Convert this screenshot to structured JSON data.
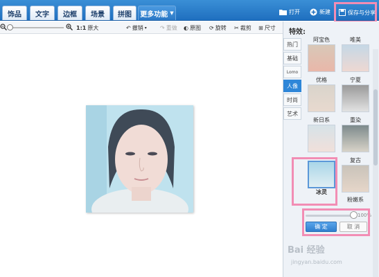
{
  "tabs": [
    "饰品",
    "文字",
    "边框",
    "场景",
    "拼图"
  ],
  "more_tab": "更多功能",
  "top_actions": {
    "open": "打开",
    "new": "新建",
    "save_share": "保存与分享"
  },
  "toolbar": {
    "ratio": "1:1",
    "original_size": "原大",
    "undo": "撤销",
    "redo": "重做",
    "compare": "原图",
    "rotate": "旋转",
    "crop": "裁剪",
    "size": "尺寸"
  },
  "panel": {
    "title": "特效:",
    "categories": [
      "热门",
      "基础",
      "Lomo",
      "人像",
      "时尚",
      "艺术"
    ],
    "active_category": "人像",
    "effects": [
      {
        "label": "阿宝色"
      },
      {
        "label": "唯美"
      },
      {
        "label": "优格"
      },
      {
        "label": "宁夏"
      },
      {
        "label": "新日系"
      },
      {
        "label": "重染"
      },
      {
        "label": "冰灵"
      },
      {
        "label": "复古"
      },
      {
        "label": "粉嫩系"
      }
    ],
    "selected_effect": "冰灵",
    "opacity_value": "100%",
    "confirm": "确 定",
    "cancel": "取 消"
  },
  "watermark": {
    "main": "Bai 经验",
    "sub": "jingyan.baidu.com"
  },
  "colors": {
    "top_bar": "#2a7fcb",
    "highlight": "#f28db4",
    "accent": "#2e86d8"
  }
}
